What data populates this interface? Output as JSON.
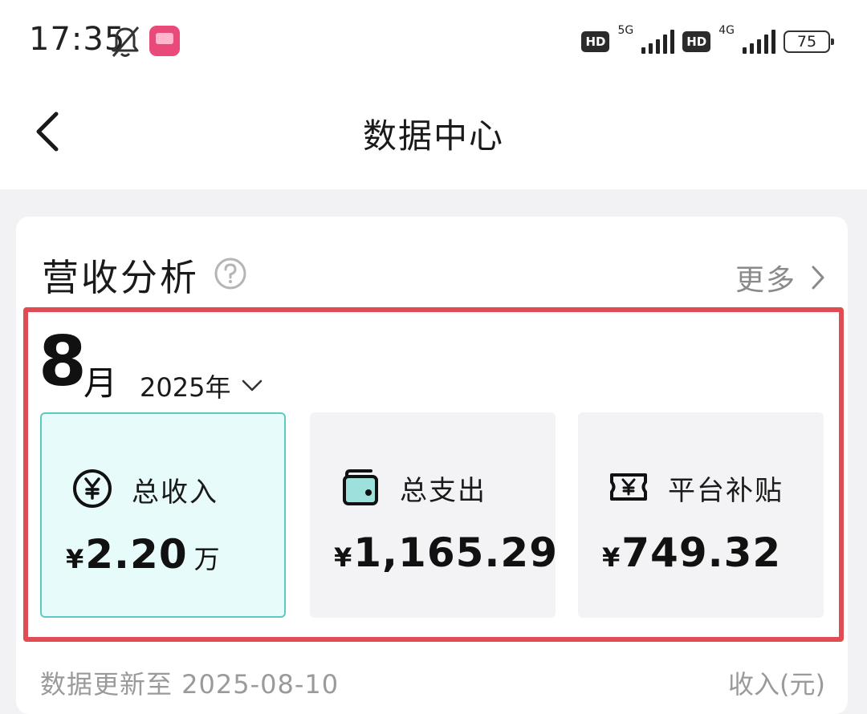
{
  "status_bar": {
    "time": "17:35",
    "hd_label": "HD",
    "network_1": "5G",
    "network_2": "4G",
    "battery": "75"
  },
  "nav": {
    "title": "数据中心",
    "back_icon": "chevron-left-icon"
  },
  "section": {
    "title": "营收分析",
    "more_label": "更多",
    "help_icon": "question-circle-icon"
  },
  "period": {
    "month": "8",
    "month_unit": "月",
    "year": "2025年"
  },
  "stats": [
    {
      "label": "总收入",
      "currency": "¥",
      "amount": "2.20",
      "unit": "万",
      "icon": "yuan-coin-icon",
      "selected": true
    },
    {
      "label": "总支出",
      "currency": "¥",
      "amount": "1,165.29",
      "unit": "",
      "icon": "wallet-icon",
      "selected": false
    },
    {
      "label": "平台补贴",
      "currency": "¥",
      "amount": "749.32",
      "unit": "",
      "icon": "coupon-ticket-icon",
      "selected": false
    }
  ],
  "footer": {
    "update_text": "数据更新至 2025-08-10",
    "unit_text": "收入(元)"
  },
  "colors": {
    "highlight_border": "#e14b52",
    "selected_bg": "#e8fbfb",
    "selected_border": "#5cc9c5"
  }
}
